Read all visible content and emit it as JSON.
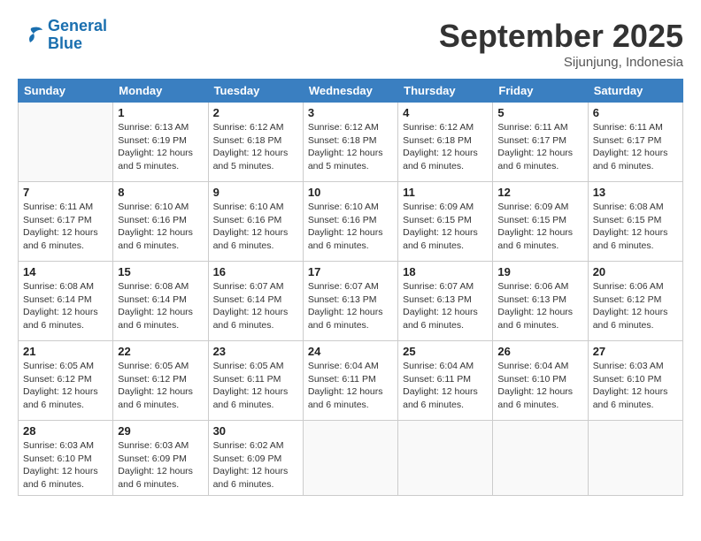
{
  "logo": {
    "line1": "General",
    "line2": "Blue"
  },
  "title": "September 2025",
  "subtitle": "Sijunjung, Indonesia",
  "days_of_week": [
    "Sunday",
    "Monday",
    "Tuesday",
    "Wednesday",
    "Thursday",
    "Friday",
    "Saturday"
  ],
  "weeks": [
    [
      {
        "day": "",
        "info": ""
      },
      {
        "day": "1",
        "info": "Sunrise: 6:13 AM\nSunset: 6:19 PM\nDaylight: 12 hours\nand 5 minutes."
      },
      {
        "day": "2",
        "info": "Sunrise: 6:12 AM\nSunset: 6:18 PM\nDaylight: 12 hours\nand 5 minutes."
      },
      {
        "day": "3",
        "info": "Sunrise: 6:12 AM\nSunset: 6:18 PM\nDaylight: 12 hours\nand 5 minutes."
      },
      {
        "day": "4",
        "info": "Sunrise: 6:12 AM\nSunset: 6:18 PM\nDaylight: 12 hours\nand 6 minutes."
      },
      {
        "day": "5",
        "info": "Sunrise: 6:11 AM\nSunset: 6:17 PM\nDaylight: 12 hours\nand 6 minutes."
      },
      {
        "day": "6",
        "info": "Sunrise: 6:11 AM\nSunset: 6:17 PM\nDaylight: 12 hours\nand 6 minutes."
      }
    ],
    [
      {
        "day": "7",
        "info": "Sunrise: 6:11 AM\nSunset: 6:17 PM\nDaylight: 12 hours\nand 6 minutes."
      },
      {
        "day": "8",
        "info": "Sunrise: 6:10 AM\nSunset: 6:16 PM\nDaylight: 12 hours\nand 6 minutes."
      },
      {
        "day": "9",
        "info": "Sunrise: 6:10 AM\nSunset: 6:16 PM\nDaylight: 12 hours\nand 6 minutes."
      },
      {
        "day": "10",
        "info": "Sunrise: 6:10 AM\nSunset: 6:16 PM\nDaylight: 12 hours\nand 6 minutes."
      },
      {
        "day": "11",
        "info": "Sunrise: 6:09 AM\nSunset: 6:15 PM\nDaylight: 12 hours\nand 6 minutes."
      },
      {
        "day": "12",
        "info": "Sunrise: 6:09 AM\nSunset: 6:15 PM\nDaylight: 12 hours\nand 6 minutes."
      },
      {
        "day": "13",
        "info": "Sunrise: 6:08 AM\nSunset: 6:15 PM\nDaylight: 12 hours\nand 6 minutes."
      }
    ],
    [
      {
        "day": "14",
        "info": "Sunrise: 6:08 AM\nSunset: 6:14 PM\nDaylight: 12 hours\nand 6 minutes."
      },
      {
        "day": "15",
        "info": "Sunrise: 6:08 AM\nSunset: 6:14 PM\nDaylight: 12 hours\nand 6 minutes."
      },
      {
        "day": "16",
        "info": "Sunrise: 6:07 AM\nSunset: 6:14 PM\nDaylight: 12 hours\nand 6 minutes."
      },
      {
        "day": "17",
        "info": "Sunrise: 6:07 AM\nSunset: 6:13 PM\nDaylight: 12 hours\nand 6 minutes."
      },
      {
        "day": "18",
        "info": "Sunrise: 6:07 AM\nSunset: 6:13 PM\nDaylight: 12 hours\nand 6 minutes."
      },
      {
        "day": "19",
        "info": "Sunrise: 6:06 AM\nSunset: 6:13 PM\nDaylight: 12 hours\nand 6 minutes."
      },
      {
        "day": "20",
        "info": "Sunrise: 6:06 AM\nSunset: 6:12 PM\nDaylight: 12 hours\nand 6 minutes."
      }
    ],
    [
      {
        "day": "21",
        "info": "Sunrise: 6:05 AM\nSunset: 6:12 PM\nDaylight: 12 hours\nand 6 minutes."
      },
      {
        "day": "22",
        "info": "Sunrise: 6:05 AM\nSunset: 6:12 PM\nDaylight: 12 hours\nand 6 minutes."
      },
      {
        "day": "23",
        "info": "Sunrise: 6:05 AM\nSunset: 6:11 PM\nDaylight: 12 hours\nand 6 minutes."
      },
      {
        "day": "24",
        "info": "Sunrise: 6:04 AM\nSunset: 6:11 PM\nDaylight: 12 hours\nand 6 minutes."
      },
      {
        "day": "25",
        "info": "Sunrise: 6:04 AM\nSunset: 6:11 PM\nDaylight: 12 hours\nand 6 minutes."
      },
      {
        "day": "26",
        "info": "Sunrise: 6:04 AM\nSunset: 6:10 PM\nDaylight: 12 hours\nand 6 minutes."
      },
      {
        "day": "27",
        "info": "Sunrise: 6:03 AM\nSunset: 6:10 PM\nDaylight: 12 hours\nand 6 minutes."
      }
    ],
    [
      {
        "day": "28",
        "info": "Sunrise: 6:03 AM\nSunset: 6:10 PM\nDaylight: 12 hours\nand 6 minutes."
      },
      {
        "day": "29",
        "info": "Sunrise: 6:03 AM\nSunset: 6:09 PM\nDaylight: 12 hours\nand 6 minutes."
      },
      {
        "day": "30",
        "info": "Sunrise: 6:02 AM\nSunset: 6:09 PM\nDaylight: 12 hours\nand 6 minutes."
      },
      {
        "day": "",
        "info": ""
      },
      {
        "day": "",
        "info": ""
      },
      {
        "day": "",
        "info": ""
      },
      {
        "day": "",
        "info": ""
      }
    ]
  ]
}
